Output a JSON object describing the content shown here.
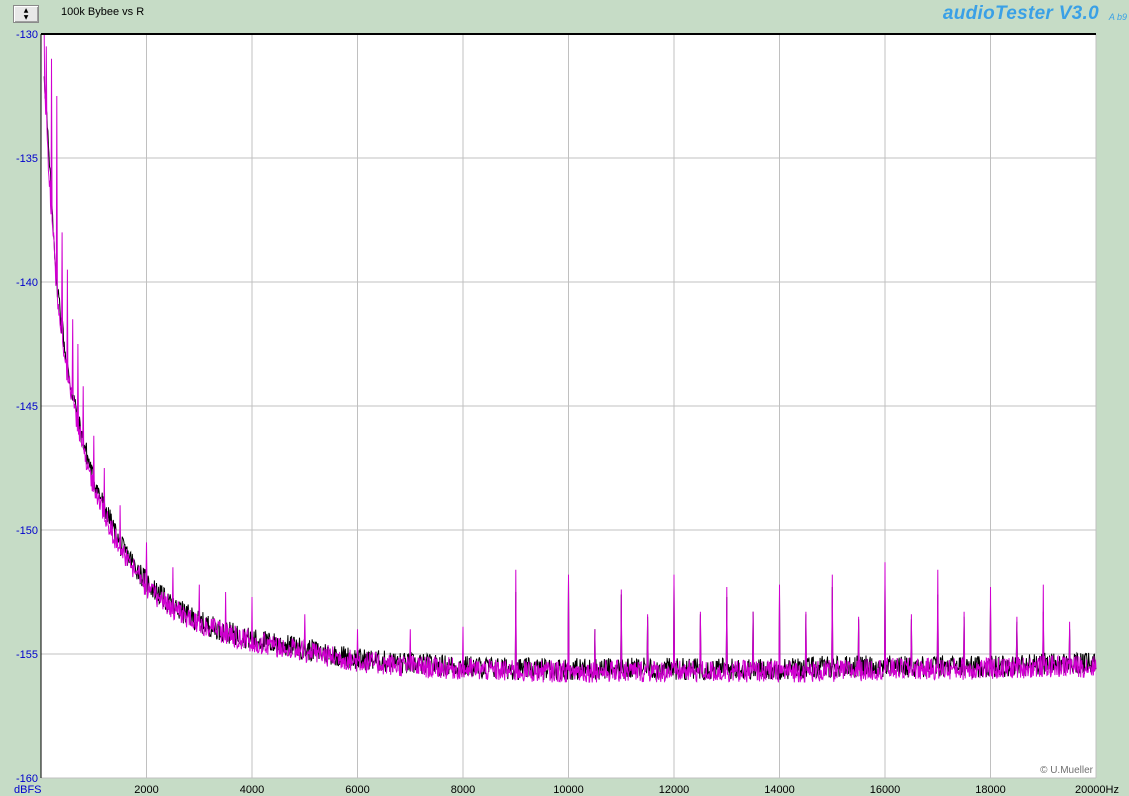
{
  "app": {
    "brand": "audioTester V3.0",
    "brand_suffix": "A b9"
  },
  "toolbar": {
    "scroll_up_icon": "triangle-up-icon",
    "scroll_down_icon": "triangle-down-icon"
  },
  "chart_data": {
    "type": "line",
    "title": "100k Bybee vs R",
    "ylabel": "dBFS",
    "xunit": "Hz",
    "xlim": [
      0,
      20000
    ],
    "ylim": [
      -160,
      -130
    ],
    "x_ticks": [
      2000,
      4000,
      6000,
      8000,
      10000,
      12000,
      14000,
      16000,
      18000,
      20000
    ],
    "x_tick_labels": [
      "2000",
      "4000",
      "6000",
      "8000",
      "10000",
      "12000",
      "14000",
      "16000",
      "18000",
      "20000Hz"
    ],
    "y_ticks": [
      -130,
      -135,
      -140,
      -145,
      -150,
      -155,
      -160
    ],
    "y_tick_labels": [
      "-130",
      "-135",
      "-140",
      "-145",
      "-150",
      "-155",
      "-160"
    ],
    "grid": true,
    "copyright": "© U.Mueller",
    "colors": {
      "background": "#ffffff",
      "grid": "#c0c0c0",
      "axis_text": "#0000cc",
      "series_black": "#000000",
      "series_magenta": "#d000d0"
    },
    "series": [
      {
        "color": "#000000",
        "x": [
          60,
          150,
          300,
          500,
          750,
          1000,
          1500,
          2000,
          2500,
          3000,
          3500,
          4000,
          5000,
          6000,
          7000,
          8000,
          9000,
          10000,
          11000,
          12000,
          13000,
          14000,
          15000,
          16000,
          17000,
          18000,
          19000,
          20000
        ],
        "values": [
          -131.5,
          -135,
          -140,
          -143.5,
          -146,
          -148,
          -150.6,
          -152.1,
          -153.1,
          -153.7,
          -154.1,
          -154.4,
          -154.8,
          -155.2,
          -155.4,
          -155.5,
          -155.6,
          -155.6,
          -155.6,
          -155.6,
          -155.6,
          -155.6,
          -155.5,
          -155.5,
          -155.5,
          -155.5,
          -155.4,
          -155.4
        ],
        "peak_freqs": [
          9000,
          10000,
          10500,
          11000,
          11500,
          12000,
          12500,
          13000,
          13500,
          14000,
          14500,
          15000,
          15500,
          16000,
          16500,
          17000,
          17500,
          18000,
          18500,
          19000,
          19500
        ],
        "peak_values": [
          -152.5,
          -152.0,
          -154.0,
          -152.6,
          -153.5,
          -152.2,
          -153.4,
          -152.7,
          -153.3,
          -152.6,
          -153.4,
          -152.3,
          -153.6,
          -152.2,
          -153.6,
          -152.6,
          -153.5,
          -153.0,
          -153.7,
          -153.3,
          -154.0
        ]
      },
      {
        "color": "#d000d0",
        "x": [
          60,
          150,
          300,
          500,
          750,
          1000,
          1500,
          2000,
          2500,
          3000,
          3500,
          4000,
          5000,
          6000,
          7000,
          8000,
          9000,
          10000,
          11000,
          12000,
          13000,
          14000,
          15000,
          16000,
          17000,
          18000,
          19000,
          20000
        ],
        "values": [
          -131.8,
          -135.5,
          -140.5,
          -143.8,
          -146.3,
          -148.3,
          -150.8,
          -152.3,
          -153.2,
          -153.8,
          -154.2,
          -154.5,
          -154.9,
          -155.3,
          -155.5,
          -155.6,
          -155.7,
          -155.7,
          -155.7,
          -155.7,
          -155.7,
          -155.7,
          -155.7,
          -155.6,
          -155.6,
          -155.6,
          -155.5,
          -155.5
        ],
        "peak_freqs": [
          50,
          100,
          200,
          300,
          400,
          500,
          600,
          700,
          800,
          1000,
          1200,
          1500,
          2000,
          2500,
          3000,
          3500,
          4000,
          5000,
          6000,
          7000,
          8000,
          9000,
          10000,
          10500,
          11000,
          11500,
          12000,
          12500,
          13000,
          13500,
          14000,
          14500,
          15000,
          15500,
          16000,
          16500,
          17000,
          17500,
          18000,
          18500,
          19000,
          19500
        ],
        "peak_values": [
          -130,
          -130.5,
          -131,
          -132.5,
          -138,
          -139.5,
          -141.5,
          -142.5,
          -144.2,
          -146.2,
          -147.5,
          -149.0,
          -150.5,
          -151.5,
          -152.2,
          -152.5,
          -152.7,
          -153.4,
          -154.0,
          -154.0,
          -153.9,
          -151.6,
          -151.8,
          -154.0,
          -152.4,
          -153.4,
          -151.8,
          -153.3,
          -152.3,
          -153.3,
          -152.2,
          -153.3,
          -151.8,
          -153.5,
          -151.3,
          -153.4,
          -151.6,
          -153.3,
          -152.3,
          -153.5,
          -152.2,
          -153.7
        ]
      }
    ]
  }
}
